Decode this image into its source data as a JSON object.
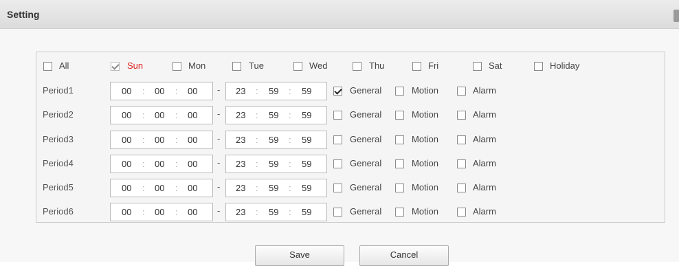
{
  "dialog": {
    "title": "Setting"
  },
  "days": [
    {
      "label": "All",
      "checked": false,
      "color": "#444444"
    },
    {
      "label": "Sun",
      "checked": true,
      "color": "#e02020"
    },
    {
      "label": "Mon",
      "checked": false,
      "color": "#444444"
    },
    {
      "label": "Tue",
      "checked": false,
      "color": "#444444"
    },
    {
      "label": "Wed",
      "checked": false,
      "color": "#444444"
    },
    {
      "label": "Thu",
      "checked": false,
      "color": "#444444"
    },
    {
      "label": "Fri",
      "checked": false,
      "color": "#444444"
    },
    {
      "label": "Sat",
      "checked": false,
      "color": "#444444"
    },
    {
      "label": "Holiday",
      "checked": false,
      "color": "#444444"
    }
  ],
  "periods": [
    {
      "label": "Period1",
      "start": [
        "00",
        "00",
        "00"
      ],
      "end": [
        "23",
        "59",
        "59"
      ],
      "general": true,
      "motion": false,
      "alarm": false
    },
    {
      "label": "Period2",
      "start": [
        "00",
        "00",
        "00"
      ],
      "end": [
        "23",
        "59",
        "59"
      ],
      "general": false,
      "motion": false,
      "alarm": false
    },
    {
      "label": "Period3",
      "start": [
        "00",
        "00",
        "00"
      ],
      "end": [
        "23",
        "59",
        "59"
      ],
      "general": false,
      "motion": false,
      "alarm": false
    },
    {
      "label": "Period4",
      "start": [
        "00",
        "00",
        "00"
      ],
      "end": [
        "23",
        "59",
        "59"
      ],
      "general": false,
      "motion": false,
      "alarm": false
    },
    {
      "label": "Period5",
      "start": [
        "00",
        "00",
        "00"
      ],
      "end": [
        "23",
        "59",
        "59"
      ],
      "general": false,
      "motion": false,
      "alarm": false
    },
    {
      "label": "Period6",
      "start": [
        "00",
        "00",
        "00"
      ],
      "end": [
        "23",
        "59",
        "59"
      ],
      "general": false,
      "motion": false,
      "alarm": false
    }
  ],
  "type_labels": {
    "general": "General",
    "motion": "Motion",
    "alarm": "Alarm"
  },
  "time_separator": ":",
  "range_separator": "-",
  "buttons": {
    "save": "Save",
    "cancel": "Cancel"
  },
  "icons": {
    "close": "close-icon"
  }
}
